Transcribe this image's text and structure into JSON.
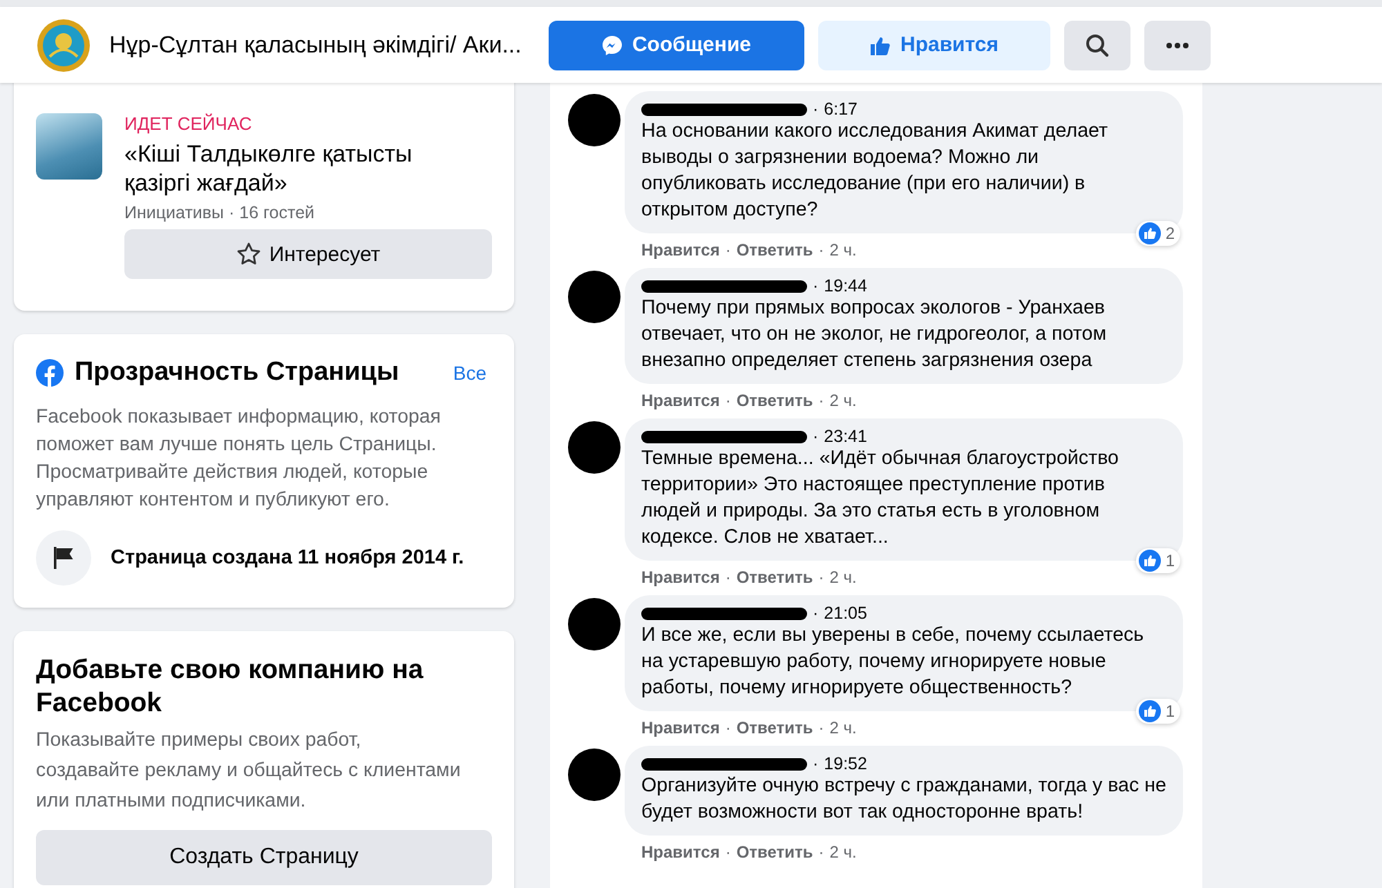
{
  "header": {
    "page_name": "Нұр-Сұлтан қаласының әкімдігі/ Аки...",
    "buttons": [
      {
        "kind": "message",
        "label": "Сообщение"
      },
      {
        "kind": "like",
        "label": "Нравится"
      },
      {
        "kind": "search"
      },
      {
        "kind": "more"
      }
    ]
  },
  "event_card": {
    "status": "ИДЕТ СЕЙЧАС",
    "title": "«Кіші Талдыкөлге қатысты қазіргі жағдай»",
    "meta": "Инициативы · 16 гостей",
    "button": "Интересует"
  },
  "transparency": {
    "title": "Прозрачность Страницы",
    "see_all": "Все",
    "description": "Facebook показывает информацию, которая поможет вам лучше понять цель Страницы. Просматривайте действия людей, которые управляют контентом и публикуют его.",
    "created": "Страница создана 11 ноября 2014 г."
  },
  "promo": {
    "title": "Добавьте свою компанию на Facebook",
    "description": "Показывайте примеры своих работ, создавайте рекламу и общайтесь с клиентами или платными подписчиками.",
    "button": "Создать Страницу"
  },
  "comments": [
    {
      "time": "6:17",
      "text": "На основании какого исследования Акимат делает выводы о загрязнении водоема? Можно ли опубликовать исследование (при его наличии) в открытом доступе?",
      "reactions": "2",
      "sep": "·",
      "like": "Нравится",
      "reply": "Ответить",
      "age": "2 ч."
    },
    {
      "time": "19:44",
      "text": "Почему при прямых вопросах экологов - Уранхаев отвечает, что он не эколог, не гидрогеолог, а потом внезапно определяет степень загрязнения озера",
      "sep": "·",
      "like": "Нравится",
      "reply": "Ответить",
      "age": "2 ч."
    },
    {
      "time": "23:41",
      "text": "Темные времена... «Идёт обычная благоустройство территории» Это настоящее преступление против людей и природы. За это статья есть в уголовном кодексе. Слов не хватает...",
      "reactions": "1",
      "sep": "·",
      "like": "Нравится",
      "reply": "Ответить",
      "age": "2 ч."
    },
    {
      "time": "21:05",
      "text": "И все же, если вы уверены в себе, почему ссылаетесь на устаревшую работу, почему игнорируете новые работы, почему игнорируете общественность?",
      "reactions": "1",
      "sep": "·",
      "like": "Нравится",
      "reply": "Ответить",
      "age": "2 ч."
    },
    {
      "time": "19:52",
      "text": "Организуйте очную встречу с гражданами, тогда у вас не будет возможности вот так односторонне врать!",
      "sep": "·",
      "like": "Нравится",
      "reply": "Ответить",
      "age": "2 ч."
    }
  ]
}
